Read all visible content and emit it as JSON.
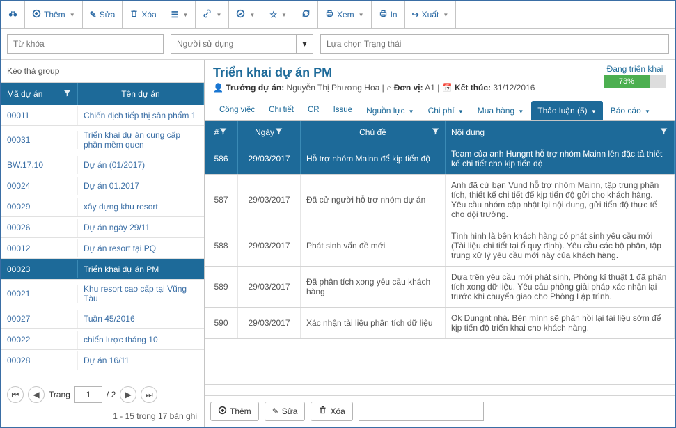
{
  "toolbar": {
    "add": "Thêm",
    "edit": "Sửa",
    "delete": "Xóa",
    "view": "Xem",
    "print": "In",
    "export": "Xuất"
  },
  "filters": {
    "keyword_ph": "Từ khóa",
    "user_ph": "Người sử dụng",
    "status_ph": "Lựa chọn Trạng thái"
  },
  "left": {
    "groupzone": "Kéo thả group",
    "col_id": "Mã dự án",
    "col_name": "Tên dự án",
    "rows": [
      {
        "id": "00011",
        "name": "Chiến dịch tiếp thị sản phẩm 1"
      },
      {
        "id": "00031",
        "name": "Triển khai dự án cung cấp phần mềm quen"
      },
      {
        "id": "BW.17.10",
        "name": "Dự án (01/2017)"
      },
      {
        "id": "00024",
        "name": "Dự án 01.2017"
      },
      {
        "id": "00029",
        "name": "xây dựng khu resort"
      },
      {
        "id": "00026",
        "name": "Dự án ngày 29/11"
      },
      {
        "id": "00012",
        "name": "Dự án resort tại PQ"
      },
      {
        "id": "00023",
        "name": "Triển khai dự án PM"
      },
      {
        "id": "00021",
        "name": "Khu resort cao cấp tại Vũng Tàu"
      },
      {
        "id": "00027",
        "name": "Tuần 45/2016"
      },
      {
        "id": "00022",
        "name": "chiến lược tháng 10"
      },
      {
        "id": "00028",
        "name": "Dự án 16/11"
      }
    ],
    "pager": {
      "label": "Trang",
      "current": "1",
      "total": "/ 2",
      "info": "1 - 15 trong 17 bản ghi"
    }
  },
  "detail": {
    "title": "Triển khai dự án PM",
    "manager_lbl": "Trưởng dự án:",
    "manager": "Nguyễn Thị Phương Hoa",
    "unit_lbl": "Đơn vị:",
    "unit": "A1",
    "end_lbl": "Kết thúc:",
    "end": "31/12/2016",
    "progress_lbl": "Đang triển khai",
    "progress_pct": "73%",
    "progress_width": "73%"
  },
  "tabs": {
    "task": "Công việc",
    "detail": "Chi tiết",
    "cr": "CR",
    "issue": "Issue",
    "resource": "Nguồn lực",
    "cost": "Chi phí",
    "purchase": "Mua hàng",
    "discuss": "Thảo luận (5)",
    "report": "Báo cáo"
  },
  "discuss": {
    "col_num": "#",
    "col_date": "Ngày",
    "col_subject": "Chủ đề",
    "col_body": "Nội dung",
    "rows": [
      {
        "num": "586",
        "date": "29/03/2017",
        "subj": "Hỗ trợ nhóm Mainn để kịp tiến độ",
        "body": "Team của anh Hungnt hỗ trợ nhóm Mainn lên đặc tả thiết kế chi tiết cho kịp tiến độ"
      },
      {
        "num": "587",
        "date": "29/03/2017",
        "subj": "Đã cử người hỗ trợ nhóm dự án",
        "body": "Anh đã cử bạn Vund hỗ trợ nhóm Mainn, tập trung phân tích, thiết kế chi tiết để kịp tiến độ gửi cho khách hàng. Yêu cầu nhóm cập nhật lại nội dung, gửi tiến độ thực tế cho đội trưởng."
      },
      {
        "num": "588",
        "date": "29/03/2017",
        "subj": "Phát sinh vấn đề mới",
        "body": "Tình hình là bên khách hàng có phát sinh yêu cầu mới (Tài liệu chi tiết tại ổ quy định). Yêu cầu các bộ phận, tập trung xử lý yêu cầu mới này của khách hàng."
      },
      {
        "num": "589",
        "date": "29/03/2017",
        "subj": "Đã phân tích xong yêu cầu khách hàng",
        "body": "Dựa trên yêu cầu mới phát sinh, Phòng kĩ thuật 1 đã phân tích xong dữ liệu. Yêu cầu phòng giải pháp xác nhận lại trước khi chuyển giao cho Phòng Lập trình."
      },
      {
        "num": "590",
        "date": "29/03/2017",
        "subj": "Xác nhận tài liệu phân tích dữ liệu",
        "body": "Ok Dungnt nhá. Bên mình sẽ phản hồi lại tài liệu sớm để kịp tiến độ triển khai cho khách hàng."
      }
    ],
    "footer": {
      "add": "Thêm",
      "edit": "Sửa",
      "delete": "Xóa"
    }
  }
}
